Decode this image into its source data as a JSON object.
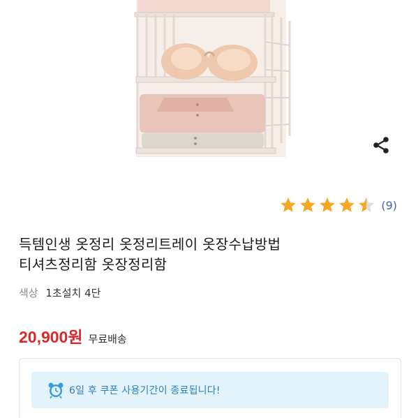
{
  "product": {
    "rating": 4.5,
    "review_count": "(9)",
    "title_line1": "득템인생 옷정리 옷정리트레이 옷장수납방법",
    "title_line2": "티셔츠정리함 옷장정리함",
    "option_label": "색상",
    "option_value": "1초설치 4단",
    "price": "20,900원",
    "shipping": "무료배송"
  },
  "coupon": {
    "message": "6일 후 쿠폰 사용기간이 종료됩니다!"
  },
  "colors": {
    "price": "#d9292c",
    "star": "#f5a623",
    "review_link": "#4a5fb8",
    "coupon_bg": "#e3f3fb",
    "coupon_text": "#2f7fb8"
  },
  "icons": {
    "share": "share-icon",
    "star": "star-icon",
    "alarm": "alarm-clock-icon"
  }
}
